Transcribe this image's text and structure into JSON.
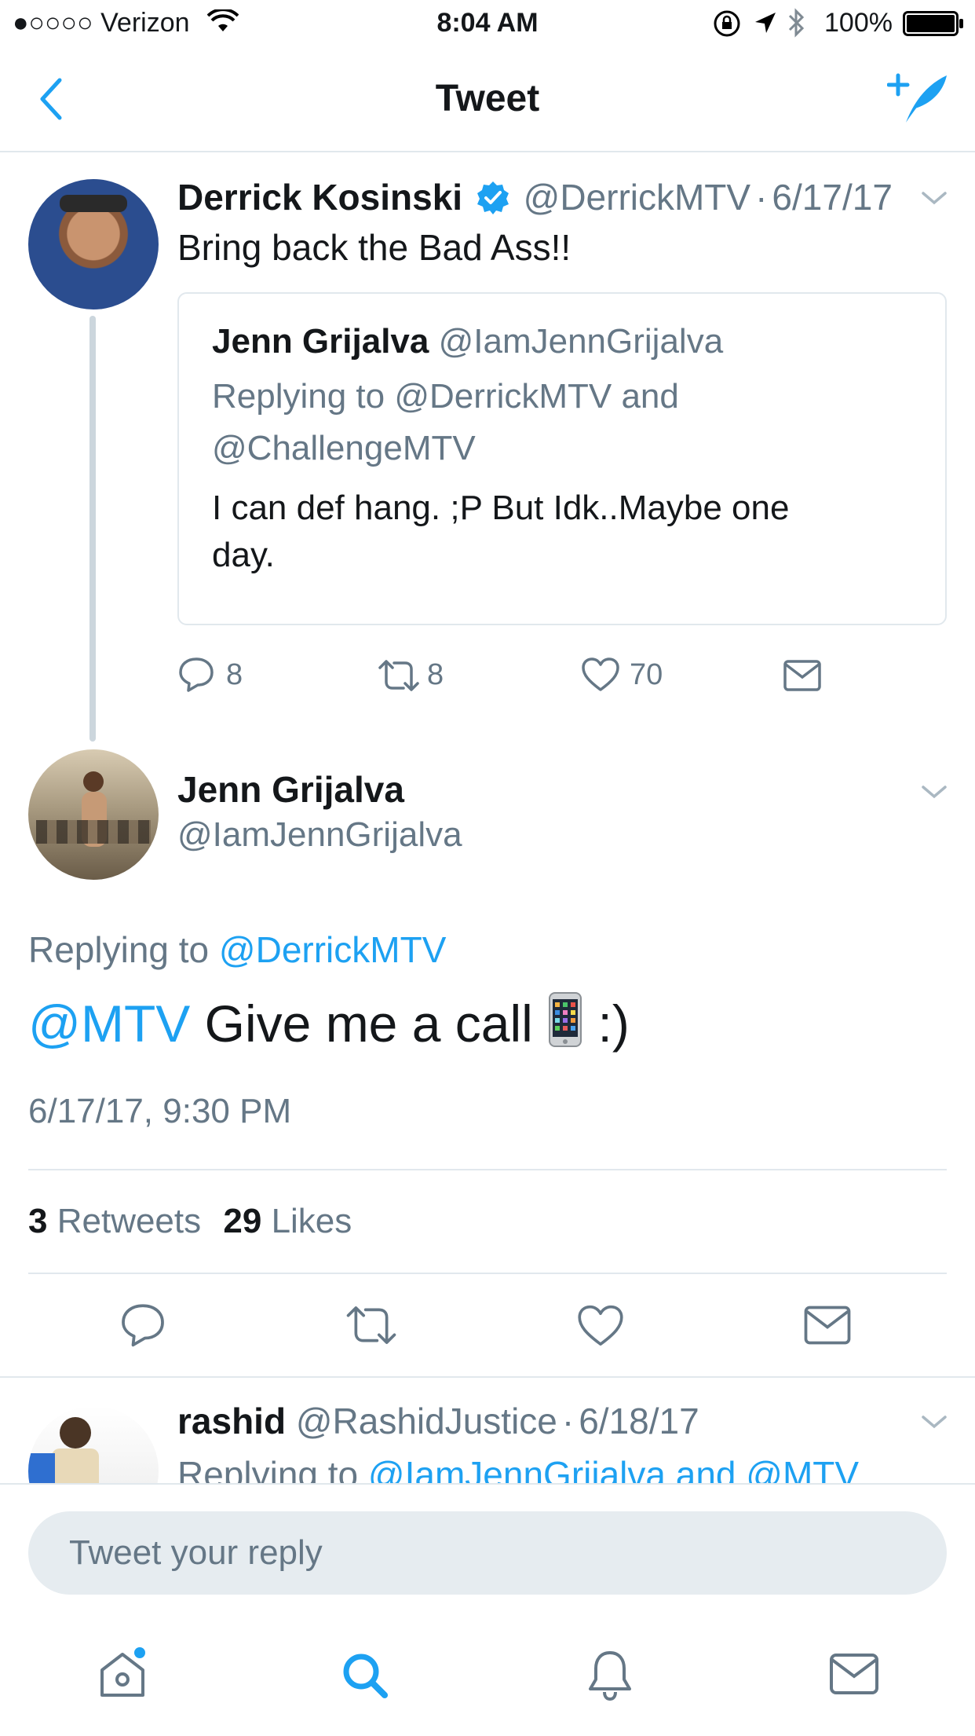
{
  "status_bar": {
    "carrier": "●○○○○ Verizon",
    "time": "8:04 AM",
    "battery": "100%"
  },
  "nav": {
    "title": "Tweet",
    "back_icon": "chevron-left-icon",
    "compose_icon": "compose-tweet-icon"
  },
  "parent_tweet": {
    "name": "Derrick Kosinski",
    "handle": "@DerrickMTV",
    "sep": "·",
    "date": "6/17/17",
    "text": "Bring back the Bad Ass!!",
    "quoted": {
      "name": "Jenn Grijalva",
      "handle": "@IamJennGrijalva",
      "replying_line1": "Replying to @DerrickMTV and",
      "replying_line2": "@ChallengeMTV",
      "text_line1": "I can def hang. ;P But Idk..Maybe one",
      "text_line2": "day."
    },
    "actions": {
      "replies": "8",
      "retweets": "8",
      "likes": "70"
    }
  },
  "main_tweet": {
    "name": "Jenn Grijalva",
    "handle": "@IamJennGrijalva",
    "replying_prefix": "Replying to ",
    "replying_to": "@DerrickMTV",
    "mention": "@MTV",
    "text": " Give me a call ",
    "emoji_icon": "mobile-phone-icon",
    "text_end": " :)",
    "timestamp": "6/17/17, 9:30 PM",
    "retweet_count": "3",
    "retweet_label": "Retweets",
    "like_count": "29",
    "like_label": "Likes"
  },
  "next_reply": {
    "name": "rashid",
    "handle": "@RashidJustice",
    "sep": "·",
    "date": "6/18/17",
    "replying_prefix": "Replying to ",
    "replying_to": "@IamJennGrijalva and @MTV"
  },
  "reply_input": {
    "placeholder": "Tweet your reply"
  },
  "tab_bar": {
    "items": [
      "home-icon",
      "search-icon",
      "notifications-icon",
      "messages-icon"
    ]
  },
  "colors": {
    "accent": "#1da1f2",
    "secondary_text": "#657786",
    "divider": "#e1e8ed",
    "verified": "#1da1f2"
  }
}
